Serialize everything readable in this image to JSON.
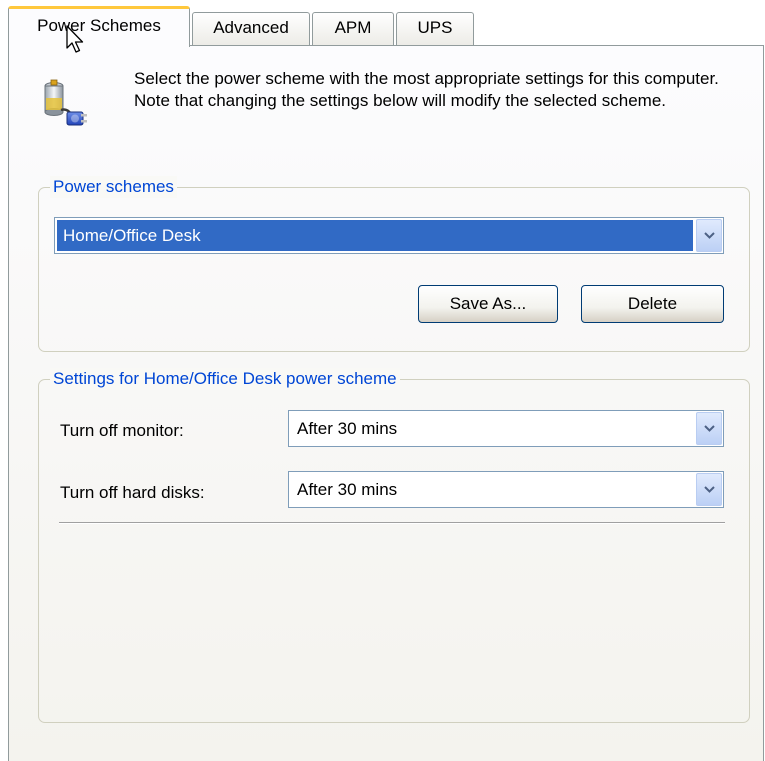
{
  "tabs": [
    {
      "label": "Power Schemes",
      "active": true
    },
    {
      "label": "Advanced",
      "active": false
    },
    {
      "label": "APM",
      "active": false
    },
    {
      "label": "UPS",
      "active": false
    }
  ],
  "intro": {
    "icon": "power-scheme-icon",
    "text": "Select the power scheme with the most appropriate settings for this computer. Note that changing the settings below will modify the selected scheme."
  },
  "power_schemes": {
    "title": "Power schemes",
    "selected": "Home/Office Desk",
    "save_as_label": "Save As...",
    "delete_label": "Delete"
  },
  "settings": {
    "title": "Settings for Home/Office Desk power scheme",
    "monitor_label": "Turn off monitor:",
    "monitor_value": "After 30 mins",
    "hard_disks_label": "Turn off hard disks:",
    "hard_disks_value": "After 30 mins"
  },
  "colors": {
    "group_title": "#0046d5",
    "selection": "#316ac5",
    "active_tab_accent": "#ffc83c"
  }
}
